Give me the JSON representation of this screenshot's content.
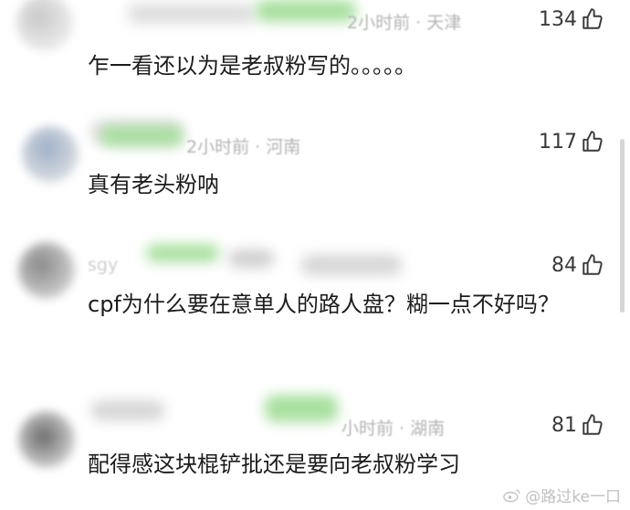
{
  "comments": [
    {
      "meta": "2小时前 · 天津",
      "likes": "134",
      "text": "乍一看还以为是老叔粉写的。。。。。"
    },
    {
      "meta": "2小时前 · 河南",
      "likes": "117",
      "text": "真有老头粉呐"
    },
    {
      "meta": "sgy",
      "likes": "84",
      "text": "cpf为什么要在意单人的路人盘？糊一点不好吗？"
    },
    {
      "meta": "小时前 · 湖南",
      "likes": "81",
      "text": "配得感这块棍铲批还是要向老叔粉学习"
    }
  ],
  "watermark": "@路过ke一口",
  "colors": {
    "blur_green": "#a9e0a0",
    "blur_gray": "#d8d8d8"
  },
  "icons": {
    "like": "thumbs-up-icon",
    "weibo": "weibo-icon"
  }
}
